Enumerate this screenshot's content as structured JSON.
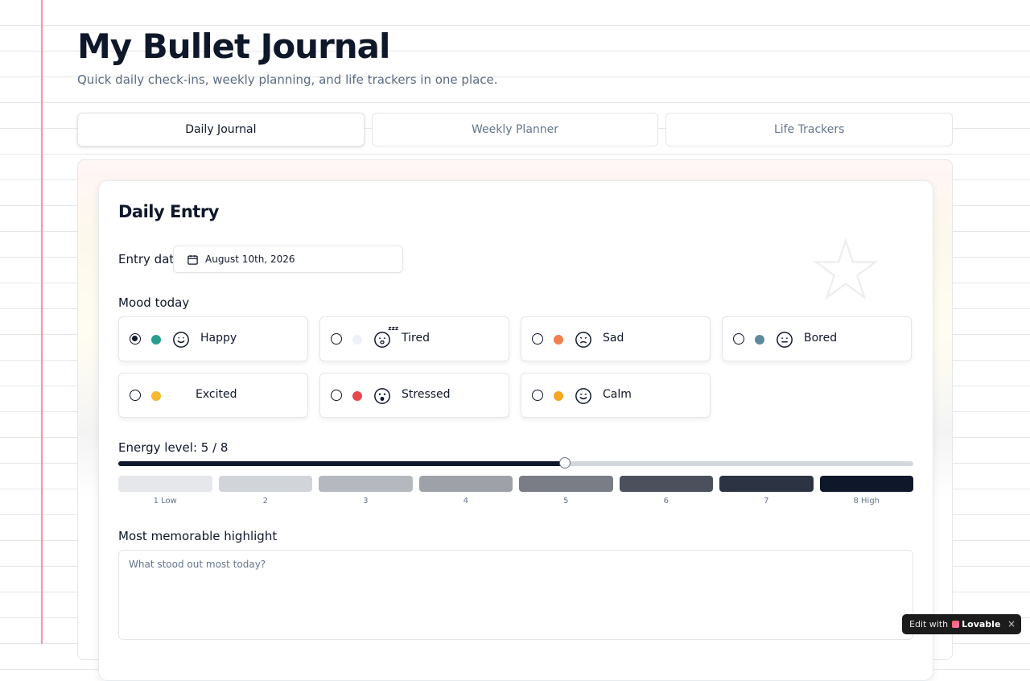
{
  "header": {
    "title": "My Bullet Journal",
    "subtitle": "Quick daily check-ins, weekly planning, and life trackers in one place."
  },
  "tabs": [
    {
      "label": "Daily Journal",
      "active": true
    },
    {
      "label": "Weekly Planner",
      "active": false
    },
    {
      "label": "Life Trackers",
      "active": false
    }
  ],
  "daily_entry": {
    "title": "Daily Entry",
    "date_label": "Entry date",
    "date_value": "August 10th, 2026",
    "mood_label": "Mood today",
    "moods": [
      {
        "label": "Happy",
        "color": "#2a9d8f",
        "icon": "smile-icon",
        "selected": true
      },
      {
        "label": "Tired",
        "color": "#eef2f8",
        "icon": "sleepy-face-icon",
        "selected": false
      },
      {
        "label": "Sad",
        "color": "#f08050",
        "icon": "frown-icon",
        "selected": false
      },
      {
        "label": "Bored",
        "color": "#5c8a9a",
        "icon": "neutral-face-icon",
        "selected": false
      },
      {
        "label": "Excited",
        "color": "#f5b82e",
        "icon": "",
        "selected": false
      },
      {
        "label": "Stressed",
        "color": "#e5484d",
        "icon": "stressed-face-icon",
        "selected": false
      },
      {
        "label": "Calm",
        "color": "#f5a623",
        "icon": "calm-smile-icon",
        "selected": false
      }
    ],
    "energy": {
      "label": "Energy level: 5 / 8",
      "value": 5,
      "max": 8,
      "scale": [
        "1 Low",
        "2",
        "3",
        "4",
        "5",
        "6",
        "7",
        "8 High"
      ],
      "scale_colors": [
        "#e5e7eb",
        "#d1d4d9",
        "#b5b8be",
        "#9ea1a7",
        "#7a7d85",
        "#4b505c",
        "#2c3342",
        "#0f172a"
      ]
    },
    "highlight": {
      "label": "Most memorable highlight",
      "placeholder": "What stood out most today?",
      "value": ""
    }
  },
  "badge": {
    "prefix": "Edit with",
    "brand": "Lovable",
    "close": "×"
  }
}
